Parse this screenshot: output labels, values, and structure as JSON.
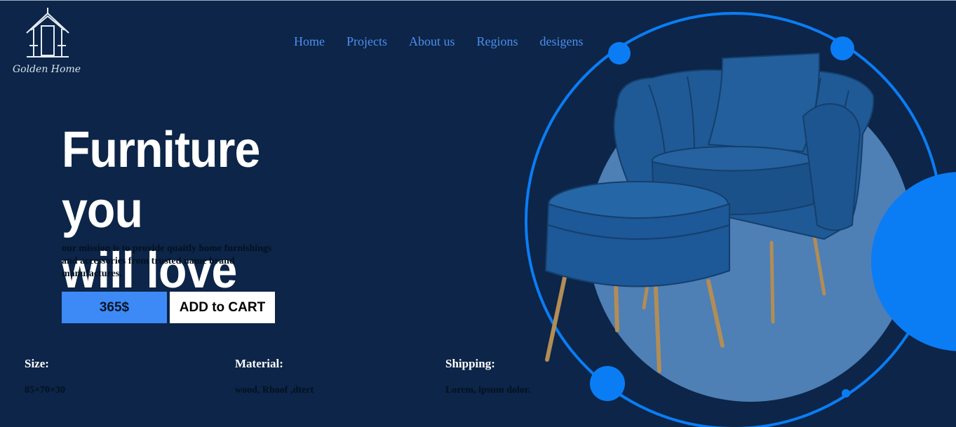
{
  "brand": {
    "logo_text": "Golden Home"
  },
  "nav": {
    "items": [
      {
        "label": "Home"
      },
      {
        "label": "Projects"
      },
      {
        "label": "About us"
      },
      {
        "label": "Regions"
      },
      {
        "label": "desigens"
      }
    ]
  },
  "hero": {
    "title_line1": "Furniture you",
    "title_line2": "will love",
    "mission": "our mission is to provide quaitly home furnishings and accessories from trusted name brand manufactures.",
    "price": "365$",
    "cta_label": "ADD to CART"
  },
  "specs": [
    {
      "label": "Size:",
      "value": "85×70×30"
    },
    {
      "label": "Material:",
      "value": "wood, Rhoof ,dtert"
    },
    {
      "label": "Shipping:",
      "value": "Lorem, ipsum dolor."
    }
  ],
  "colors": {
    "background": "#0c2548",
    "accent": "#0a7df5",
    "disc": "#4e7fb5",
    "chair": "#1f5a96"
  },
  "icons": {
    "logo": "house-icon",
    "product": "armchair-with-ottoman-image"
  }
}
